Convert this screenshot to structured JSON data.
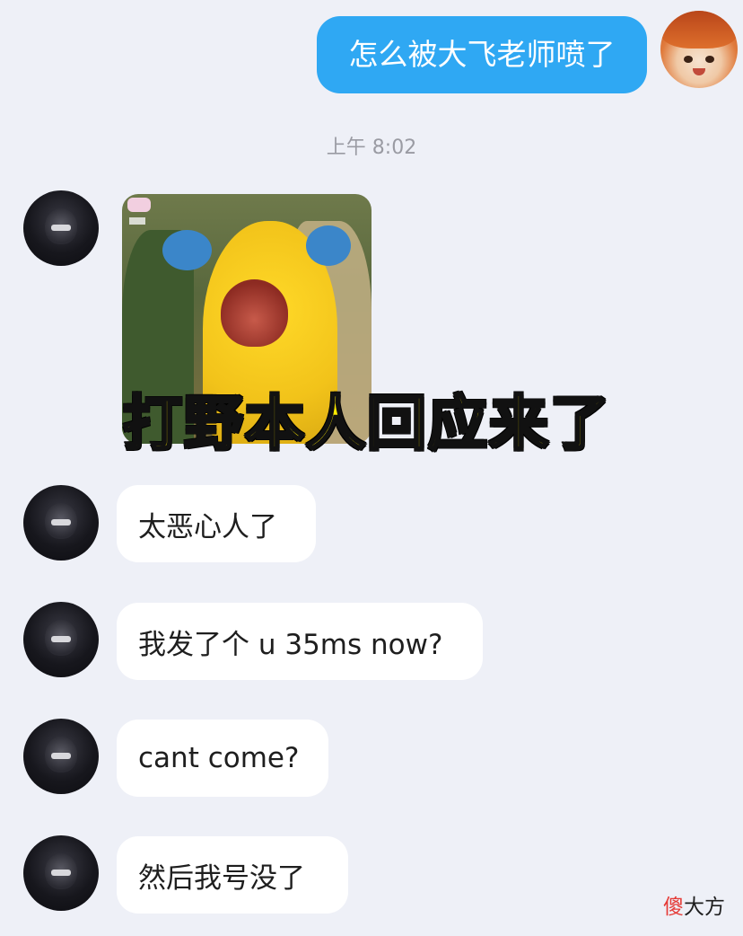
{
  "messages": {
    "me": {
      "text": "怎么被大飞老师喷了"
    },
    "time": "上午 8:02",
    "sticker": {
      "caption": "打野本人回应来了"
    },
    "replies": [
      {
        "text": "太恶心人了"
      },
      {
        "text": "我发了个 u 35ms now?"
      },
      {
        "text": "cant come?"
      },
      {
        "text": "然后我号没了"
      }
    ]
  },
  "watermark": {
    "char1": "傻",
    "rest": "大方"
  },
  "colors": {
    "sent_bubble": "#2fa8f3",
    "background": "#eef0f7",
    "caption_yellow": "#ffec00"
  }
}
